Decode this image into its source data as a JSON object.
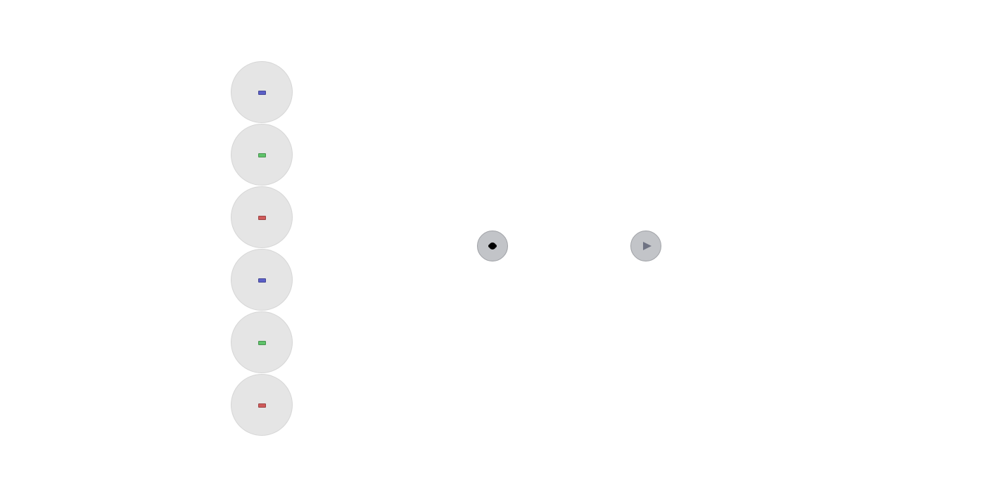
{
  "pads": [
    {
      "id": "pad-1",
      "color_name": "blue",
      "color": "#5b5fc7"
    },
    {
      "id": "pad-2",
      "color_name": "green",
      "color": "#5fc36a"
    },
    {
      "id": "pad-3",
      "color_name": "red",
      "color": "#cf5a5a"
    },
    {
      "id": "pad-4",
      "color_name": "blue",
      "color": "#5b5fc7"
    },
    {
      "id": "pad-5",
      "color_name": "green",
      "color": "#5fc36a"
    },
    {
      "id": "pad-6",
      "color_name": "red",
      "color": "#cf5a5a"
    }
  ],
  "controls": {
    "record": {
      "icon": "record-dot-icon",
      "icon_color": "#000000"
    },
    "play": {
      "icon": "play-triangle-icon",
      "icon_color": "#6f7383"
    }
  },
  "colors": {
    "background": "#ffffff",
    "pad_fill": "#e5e5e5",
    "button_fill": "#c2c4c8"
  }
}
